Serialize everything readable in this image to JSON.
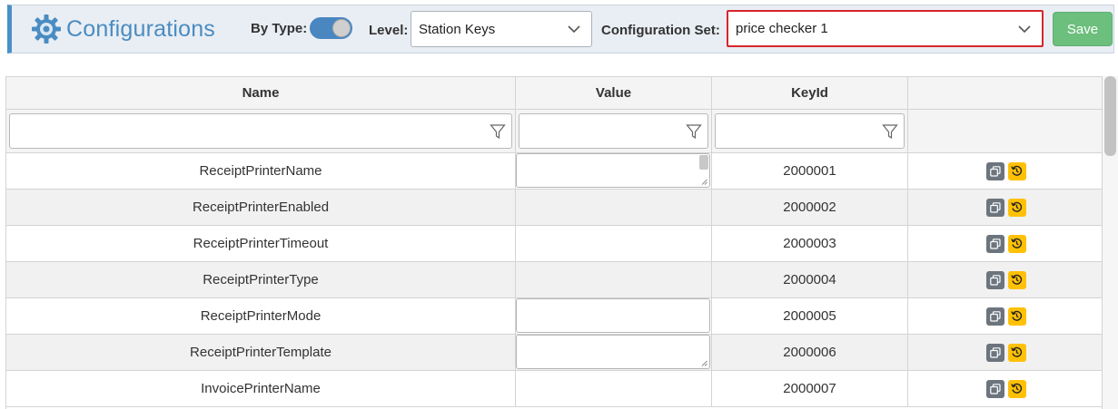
{
  "header": {
    "title": "Configurations",
    "by_type_label": "By Type:",
    "by_type_enabled": true,
    "level_label": "Level:",
    "level_value": "Station Keys",
    "config_set_label": "Configuration Set:",
    "config_set_value": "price checker 1",
    "save_label": "Save"
  },
  "table": {
    "columns": [
      "Name",
      "Value",
      "KeyId",
      ""
    ],
    "rows": [
      {
        "name": "ReceiptPrinterName",
        "value_input": "textarea",
        "key_id": "2000001"
      },
      {
        "name": "ReceiptPrinterEnabled",
        "value_input": "none",
        "key_id": "2000002"
      },
      {
        "name": "ReceiptPrinterTimeout",
        "value_input": "none",
        "key_id": "2000003"
      },
      {
        "name": "ReceiptPrinterType",
        "value_input": "none",
        "key_id": "2000004"
      },
      {
        "name": "ReceiptPrinterMode",
        "value_input": "input",
        "key_id": "2000005"
      },
      {
        "name": "ReceiptPrinterTemplate",
        "value_input": "textarea",
        "key_id": "2000006"
      },
      {
        "name": "InvoicePrinterName",
        "value_input": "none",
        "key_id": "2000007"
      }
    ]
  },
  "colors": {
    "accent": "#4a8cc2",
    "highlight_border": "#d6262c",
    "save_button": "#6cbf7d",
    "copy_button": "#6c757d",
    "reset_button": "#ffc107"
  },
  "icons": {
    "brand": "gear-icon",
    "dropdown": "chevron-down-icon",
    "filter": "filter-icon",
    "copy": "copy-icon",
    "reset": "history-icon"
  }
}
